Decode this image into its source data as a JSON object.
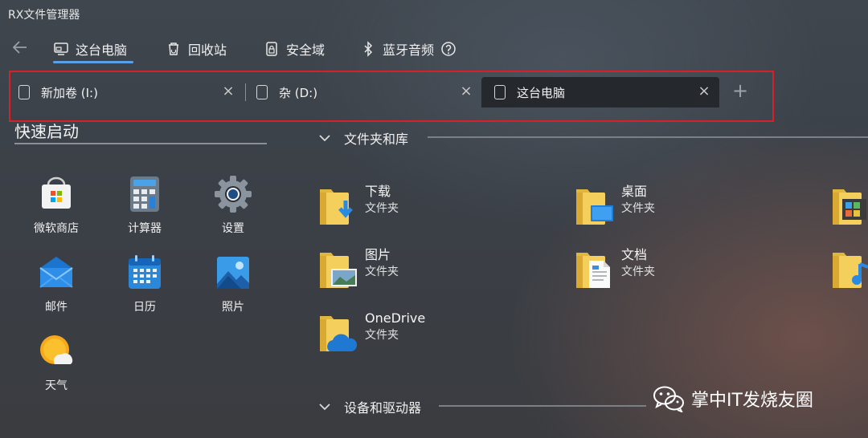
{
  "window": {
    "title": "RX文件管理器"
  },
  "nav": {
    "items": [
      {
        "label": "这台电脑",
        "icon": "this-pc-icon"
      },
      {
        "label": "回收站",
        "icon": "recycle-bin-icon"
      },
      {
        "label": "安全域",
        "icon": "secure-area-icon"
      },
      {
        "label": "蓝牙音频",
        "icon": "bluetooth-icon"
      }
    ],
    "help_icon": "help-icon",
    "back_icon": "back-arrow-icon",
    "active_index": 0,
    "accent": "#5aa0e6"
  },
  "tabs": [
    {
      "label": "新加卷 (I:)",
      "active": false
    },
    {
      "label": "杂 (D:)",
      "active": false
    },
    {
      "label": "这台电脑",
      "active": true
    }
  ],
  "highlight_color": "#d6202a",
  "quick_launch": {
    "title": "快速启动",
    "apps": [
      {
        "label": "微软商店",
        "icon": "ms-store-icon"
      },
      {
        "label": "计算器",
        "icon": "calculator-icon"
      },
      {
        "label": "设置",
        "icon": "settings-gear-icon"
      },
      {
        "label": "邮件",
        "icon": "mail-icon"
      },
      {
        "label": "日历",
        "icon": "calendar-icon"
      },
      {
        "label": "照片",
        "icon": "photos-icon"
      },
      {
        "label": "天气",
        "icon": "weather-icon"
      }
    ]
  },
  "sections": {
    "folders_title": "文件夹和库",
    "devices_title": "设备和驱动器"
  },
  "folders": [
    {
      "name": "下载",
      "type": "文件夹",
      "icon": "downloads-folder-icon"
    },
    {
      "name": "桌面",
      "type": "文件夹",
      "icon": "desktop-folder-icon"
    },
    {
      "name": "图片",
      "type": "文件夹",
      "icon": "pictures-folder-icon"
    },
    {
      "name": "文档",
      "type": "文件夹",
      "icon": "documents-folder-icon"
    },
    {
      "name": "OneDrive",
      "type": "文件夹",
      "icon": "onedrive-folder-icon"
    }
  ],
  "watermark": {
    "text": "掌中IT发烧友圈",
    "icon": "wechat-icon"
  }
}
